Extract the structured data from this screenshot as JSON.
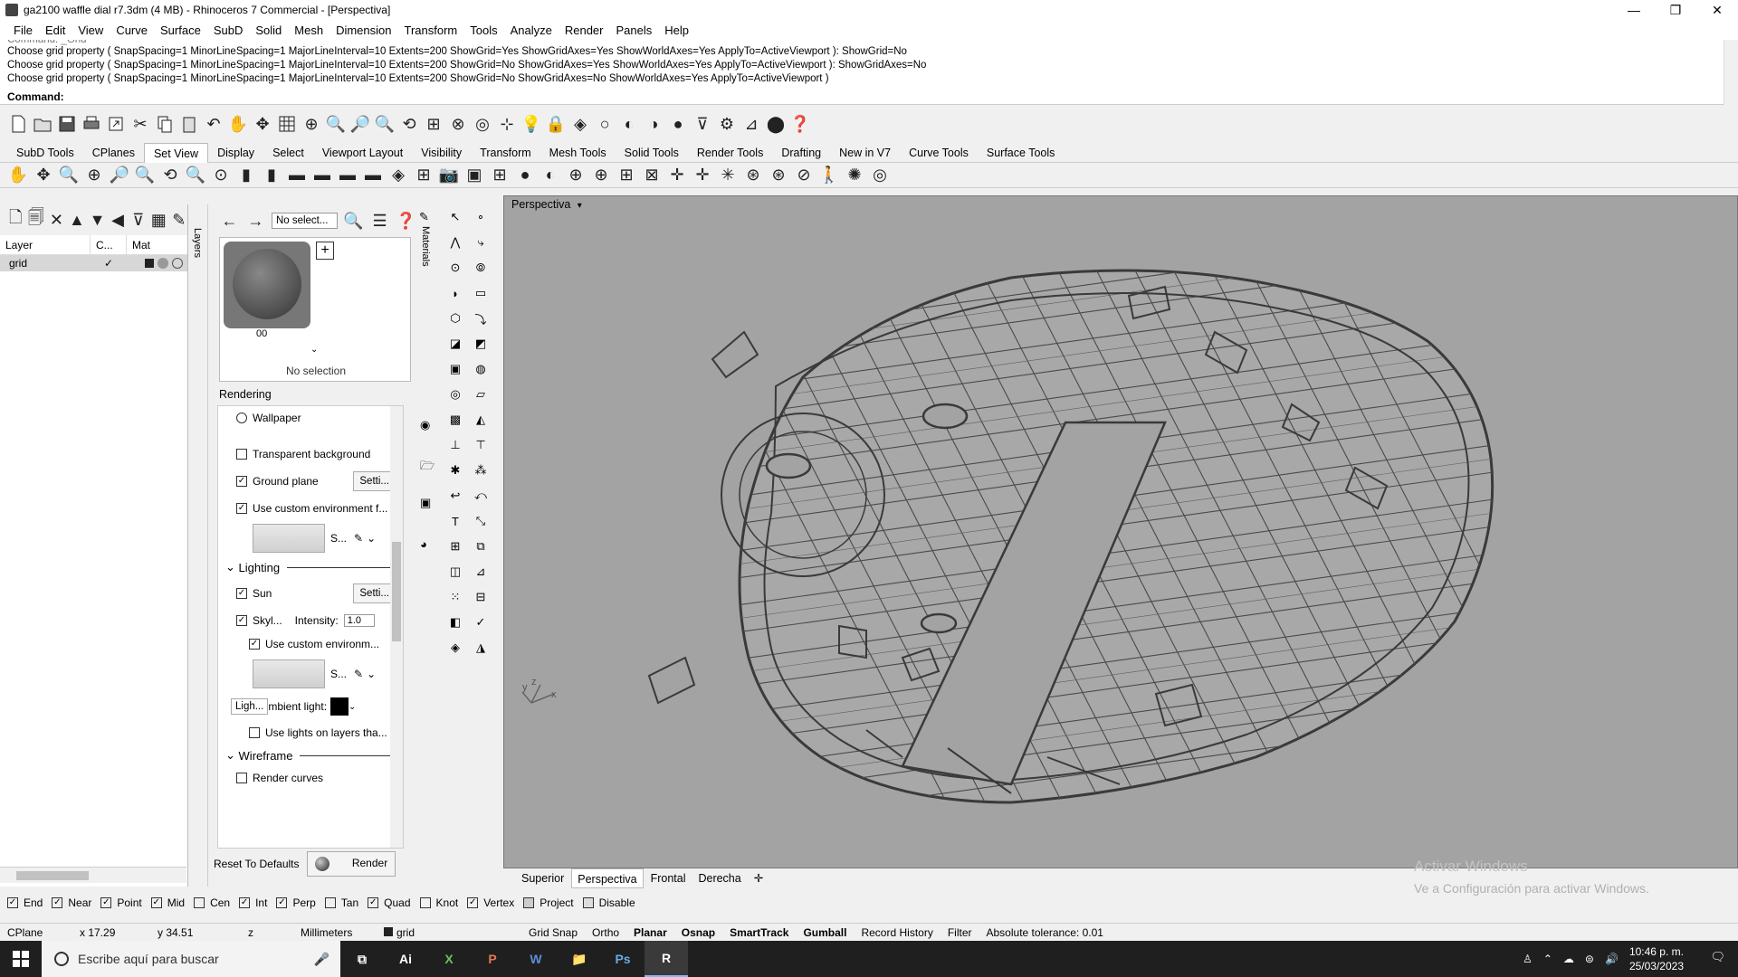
{
  "window": {
    "title": "ga2100 waffle dial r7.3dm (4 MB) - Rhinoceros 7 Commercial - [Perspectiva]",
    "minimize": "—",
    "restore": "❐",
    "close": "✕"
  },
  "menu": [
    "File",
    "Edit",
    "View",
    "Curve",
    "Surface",
    "SubD",
    "Solid",
    "Mesh",
    "Dimension",
    "Transform",
    "Tools",
    "Analyze",
    "Render",
    "Panels",
    "Help"
  ],
  "command": {
    "faded_line": "Command: _Grid",
    "history": [
      "Choose grid property ( SnapSpacing=1  MinorLineSpacing=1  MajorLineInterval=10  Extents=200  ShowGrid=Yes  ShowGridAxes=Yes  ShowWorldAxes=Yes  ApplyTo=ActiveViewport ): ShowGrid=No",
      "Choose grid property ( SnapSpacing=1  MinorLineSpacing=1  MajorLineInterval=10  Extents=200  ShowGrid=No  ShowGridAxes=Yes  ShowWorldAxes=Yes  ApplyTo=ActiveViewport ): ShowGridAxes=No",
      "Choose grid property ( SnapSpacing=1  MinorLineSpacing=1  MajorLineInterval=10  Extents=200  ShowGrid=No  ShowGridAxes=No  ShowWorldAxes=Yes  ApplyTo=ActiveViewport )"
    ],
    "prompt": "Command:"
  },
  "toolbar_tabs": [
    "SubD Tools",
    "CPlanes",
    "Set View",
    "Display",
    "Select",
    "Viewport Layout",
    "Visibility",
    "Transform",
    "Mesh Tools",
    "Solid Tools",
    "Render Tools",
    "Drafting",
    "New in V7",
    "Curve Tools",
    "Surface Tools"
  ],
  "active_tab": "Set View",
  "layers": {
    "tab_label": "Layers",
    "columns": [
      "Layer",
      "C...",
      "Mat"
    ],
    "rows": [
      {
        "name": "grid",
        "current": "✓"
      }
    ]
  },
  "properties": {
    "select_placeholder": "No select...",
    "material_caption": "00",
    "no_selection": "No selection",
    "tab_label": "Materials",
    "rendering_title": "Rendering",
    "wallpaper": "Wallpaper",
    "transparent_bg": "Transparent background",
    "ground_plane": "Ground plane",
    "settings_btn": "Setti...",
    "custom_env": "Use custom environment f...",
    "env_s": "S...",
    "lighting": "Lighting",
    "sun": "Sun",
    "sky": "Skyl...",
    "intensity_label": "Intensity:",
    "intensity_value": "1.0",
    "custom_env2": "Use custom environm...",
    "lights_btn": "Ligh...",
    "ambient": "mbient light:",
    "use_lights": "Use lights on layers tha...",
    "wireframe": "Wireframe",
    "render_curves": "Render curves",
    "reset": "Reset To Defaults",
    "render": "Render"
  },
  "viewport": {
    "title": "Perspectiva",
    "tabs": [
      "Superior",
      "Perspectiva",
      "Frontal",
      "Derecha"
    ],
    "active": "Perspectiva",
    "axis_x": "x",
    "axis_y": "y",
    "axis_z": "z"
  },
  "watermark": {
    "line1": "Activar Windows",
    "line2": "Ve a Configuración para activar Windows."
  },
  "osnaps": [
    {
      "label": "End",
      "on": true
    },
    {
      "label": "Near",
      "on": true
    },
    {
      "label": "Point",
      "on": true
    },
    {
      "label": "Mid",
      "on": true
    },
    {
      "label": "Cen",
      "on": false
    },
    {
      "label": "Int",
      "on": true
    },
    {
      "label": "Perp",
      "on": true
    },
    {
      "label": "Tan",
      "on": false
    },
    {
      "label": "Quad",
      "on": true
    },
    {
      "label": "Knot",
      "on": false
    },
    {
      "label": "Vertex",
      "on": true
    },
    {
      "label": "Project",
      "on": false
    },
    {
      "label": "Disable",
      "on": false
    }
  ],
  "status": {
    "cplane": "CPlane",
    "x": "x 17.29",
    "y": "y 34.51",
    "z": "z",
    "units": "Millimeters",
    "layer": "grid",
    "grid_snap": "Grid Snap",
    "ortho": "Ortho",
    "planar": "Planar",
    "osnap": "Osnap",
    "smarttrack": "SmartTrack",
    "gumball": "Gumball",
    "record": "Record History",
    "filter": "Filter",
    "tolerance": "Absolute tolerance: 0.01"
  },
  "taskbar": {
    "search_placeholder": "Escribe aquí para buscar",
    "apps": [
      "Ai",
      "X",
      "P",
      "W",
      "📁",
      "Ps",
      "R"
    ],
    "time": "10:46 p. m.",
    "date": "25/03/2023"
  }
}
